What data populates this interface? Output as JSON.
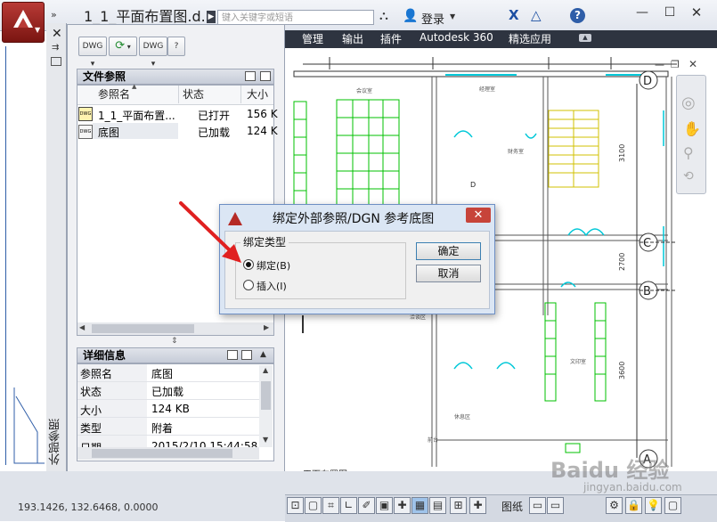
{
  "app": {
    "document_title": "1_1_平面布置图.d...",
    "search_placeholder": "键入关键字或短语",
    "login_label": "登录"
  },
  "menu": {
    "items": [
      "管理",
      "输出",
      "插件",
      "Autodesk 360",
      "精选应用"
    ]
  },
  "palette": {
    "title_vertical": "外部参照",
    "toolbar": {
      "attach_label": "DWG",
      "refresh_label": "⟳",
      "change_label": "DWG",
      "help_label": "?"
    },
    "files_section": {
      "title": "文件参照",
      "columns": [
        "参照名",
        "状态",
        "大小"
      ],
      "rows": [
        {
          "name": "1_1_平面布置...",
          "status": "已打开",
          "size": "156 K",
          "icon": "dwg-master-icon"
        },
        {
          "name": "底图",
          "status": "已加载",
          "size": "124 K",
          "icon": "dwg-file-icon"
        }
      ]
    },
    "details_section": {
      "title": "详细信息",
      "rows": [
        {
          "key": "参照名",
          "value": "底图"
        },
        {
          "key": "状态",
          "value": "已加载"
        },
        {
          "key": "大小",
          "value": "124 KB"
        },
        {
          "key": "类型",
          "value": "附着"
        },
        {
          "key": "日期",
          "value": "2015/2/10 15:44:58"
        }
      ]
    }
  },
  "dialog": {
    "title": "绑定外部参照/DGN 参考底图",
    "group_label": "绑定类型",
    "options": [
      {
        "label": "绑定(B)",
        "selected": true
      },
      {
        "label": "插入(I)",
        "selected": false
      }
    ],
    "ok_label": "确定",
    "cancel_label": "取消"
  },
  "drawing": {
    "grid_labels": [
      "D",
      "C",
      "B",
      "A"
    ],
    "room_label": "D",
    "bottom_label": "平面布置图",
    "dims": [
      "3100",
      "2700",
      "3600"
    ]
  },
  "status": {
    "coordinates": "193.1426, 132.6468, 0.0000",
    "paper_label": "图纸"
  },
  "watermark": {
    "text": "Baidu 经验",
    "sub": "jingyan.baidu.com"
  },
  "colors": {
    "accent": "#2f5ea8",
    "menubar": "#2e3440",
    "arrow": "#e02020",
    "close": "#c7443a",
    "cad_green": "#00c000",
    "cad_cyan": "#00c8d8"
  }
}
